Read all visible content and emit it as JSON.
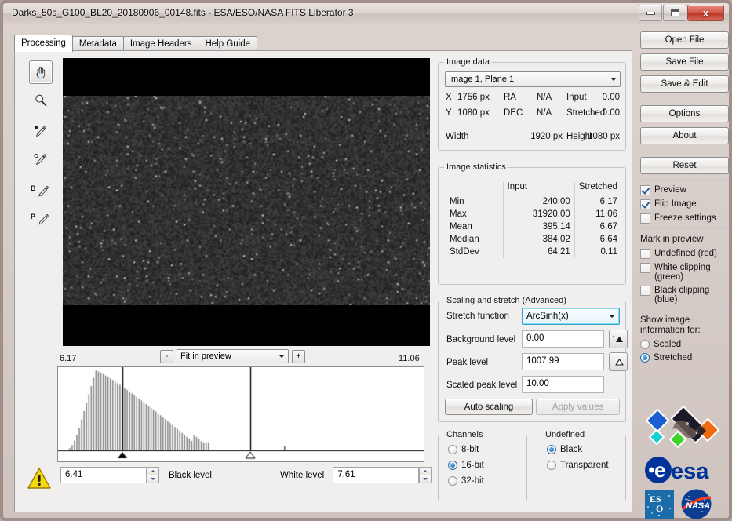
{
  "window": {
    "title": "Darks_50s_G100_BL20_20180906_00148.fits - ESA/ESO/NASA FITS Liberator 3",
    "minimize_label": "Minimize",
    "maximize_label": "Maximize",
    "close_label": "x"
  },
  "tabs": [
    {
      "label": "Processing",
      "active": true
    },
    {
      "label": "Metadata",
      "active": false
    },
    {
      "label": "Image Headers",
      "active": false
    },
    {
      "label": "Help Guide",
      "active": false
    }
  ],
  "toolbar": [
    {
      "name": "hand-tool",
      "selected": true
    },
    {
      "name": "zoom-tool",
      "selected": false
    },
    {
      "name": "black-point-picker-tool",
      "selected": false
    },
    {
      "name": "white-point-picker-tool",
      "selected": false
    },
    {
      "name": "background-picker-tool",
      "selected": false,
      "letter": "B"
    },
    {
      "name": "peak-picker-tool",
      "selected": false,
      "letter": "P"
    }
  ],
  "zoom_control": {
    "minus": "-",
    "plus": "+",
    "value": "Fit in preview"
  },
  "histogram": {
    "min_label": "6.17",
    "max_label": "11.06",
    "black_marker_pos": 0.175,
    "white_marker_pos": 0.855
  },
  "levels": {
    "black_value": "6.41",
    "black_label": "Black level",
    "white_label": "White level",
    "white_value": "7.61"
  },
  "image_data": {
    "legend": "Image data",
    "plane_select": "Image 1, Plane 1",
    "rows": [
      {
        "axis": "X",
        "px": "1756 px",
        "coord_label": "RA",
        "coord_value": "N/A",
        "mode": "Input",
        "value": "0.00"
      },
      {
        "axis": "Y",
        "px": "1080 px",
        "coord_label": "DEC",
        "coord_value": "N/A",
        "mode": "Stretched",
        "value": "0.00"
      }
    ],
    "width_label": "Width",
    "width_value": "1920 px",
    "height_label": "Height",
    "height_value": "1080 px"
  },
  "image_statistics": {
    "legend": "Image statistics",
    "columns": [
      "",
      "Input",
      "Stretched"
    ],
    "rows": [
      {
        "name": "Min",
        "input": "240.00",
        "stretched": "6.17"
      },
      {
        "name": "Max",
        "input": "31920.00",
        "stretched": "11.06"
      },
      {
        "name": "Mean",
        "input": "395.14",
        "stretched": "6.67"
      },
      {
        "name": "Median",
        "input": "384.02",
        "stretched": "6.64"
      },
      {
        "name": "StdDev",
        "input": "64.21",
        "stretched": "0.11"
      }
    ]
  },
  "scaling": {
    "legend": "Scaling and stretch (Advanced)",
    "stretch_label": "Stretch function",
    "stretch_value": "ArcSinh(x)",
    "background_label": "Background level",
    "background_value": "0.00",
    "peak_label": "Peak level",
    "peak_value": "1007.99",
    "scaled_peak_label": "Scaled peak level",
    "scaled_peak_value": "10.00",
    "auto_scaling_label": "Auto scaling",
    "apply_values_label": "Apply values"
  },
  "channels": {
    "legend": "Channels",
    "options": [
      {
        "label": "8-bit",
        "selected": false
      },
      {
        "label": "16-bit",
        "selected": true
      },
      {
        "label": "32-bit",
        "selected": false
      }
    ]
  },
  "undefined_group": {
    "legend": "Undefined",
    "options": [
      {
        "label": "Black",
        "selected": true
      },
      {
        "label": "Transparent",
        "selected": false
      }
    ]
  },
  "right_panel": {
    "buttons": [
      {
        "label": "Open File"
      },
      {
        "label": "Save File"
      },
      {
        "label": "Save & Edit"
      },
      {
        "label": "Options"
      },
      {
        "label": "About"
      },
      {
        "label": "Reset"
      }
    ],
    "checkboxes": [
      {
        "label": "Preview",
        "checked": true
      },
      {
        "label": "Flip Image",
        "checked": true
      },
      {
        "label": "Freeze settings",
        "checked": false
      }
    ],
    "mark_heading": "Mark in preview",
    "mark_checkboxes": [
      {
        "label": "Undefined (red)",
        "checked": false
      },
      {
        "label": "White clipping (green)",
        "checked": false
      },
      {
        "label": "Black clipping (blue)",
        "checked": false
      }
    ],
    "show_info_heading": "Show image information for:",
    "show_info_options": [
      {
        "label": "Scaled",
        "selected": false
      },
      {
        "label": "Stretched",
        "selected": true
      }
    ]
  },
  "logos": {
    "esa": "esa",
    "eso": "ESO",
    "nasa": "NASA"
  },
  "colors": {
    "accent": "#2aa8d6",
    "close_button": "#b93527",
    "panel_bg": "#f0efee",
    "radio_on": "#1b5f9e"
  }
}
